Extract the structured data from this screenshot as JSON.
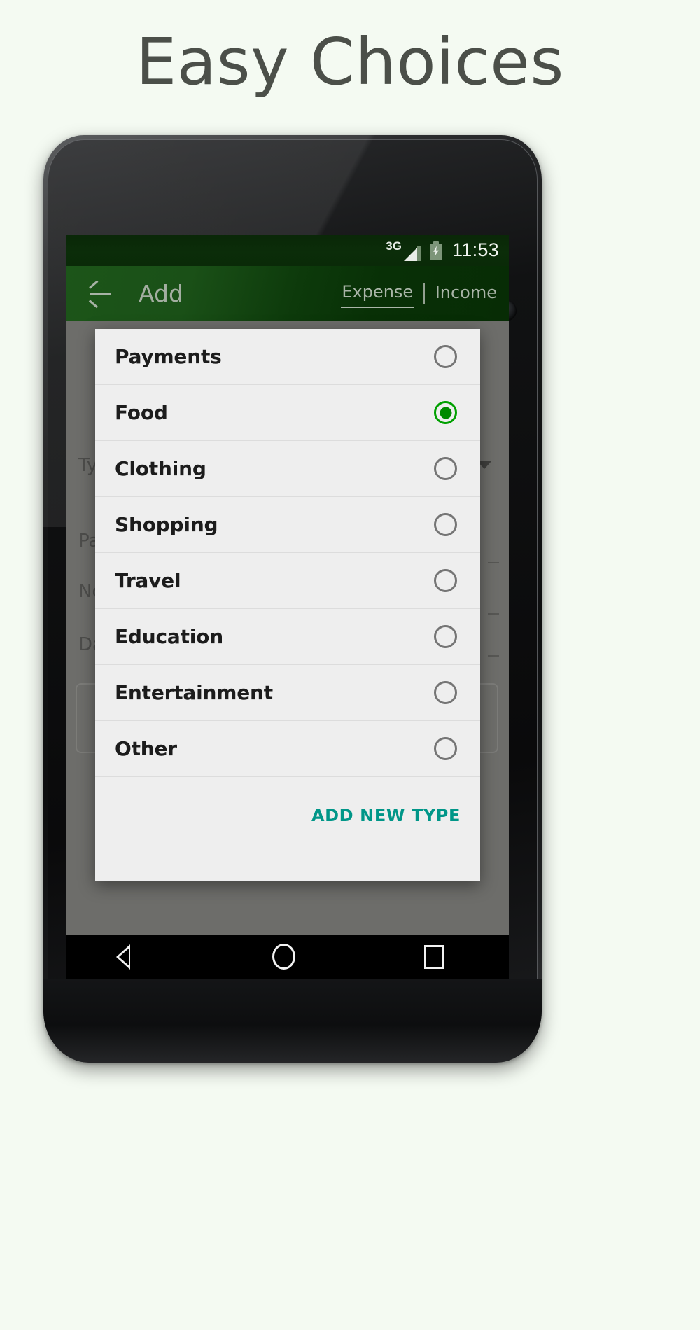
{
  "headline": "Easy Choices",
  "status_bar": {
    "network_label": "3G",
    "signal_icon": "signal-bars-icon",
    "battery_icon": "battery-charging-icon",
    "time": "11:53"
  },
  "app_bar": {
    "back_icon": "back-arrow-icon",
    "title": "Add",
    "segments": [
      {
        "label": "Expense",
        "active": true
      },
      {
        "label": "Income",
        "active": false
      }
    ]
  },
  "background_form": {
    "labels": [
      "Typ",
      "Pa",
      "No",
      "Da"
    ],
    "full_labels": [
      "Type",
      "Payment",
      "Note",
      "Date"
    ],
    "spinner_icon": "chevron-down-icon"
  },
  "dialog": {
    "options": [
      {
        "label": "Payments",
        "selected": false
      },
      {
        "label": "Food",
        "selected": true
      },
      {
        "label": "Clothing",
        "selected": false
      },
      {
        "label": "Shopping",
        "selected": false
      },
      {
        "label": "Travel",
        "selected": false
      },
      {
        "label": "Education",
        "selected": false
      },
      {
        "label": "Entertainment",
        "selected": false
      },
      {
        "label": "Other",
        "selected": false
      }
    ],
    "action_label": "ADD NEW TYPE"
  },
  "nav_bar": {
    "back_icon": "nav-back-triangle-icon",
    "home_icon": "nav-home-circle-icon",
    "recents_icon": "nav-recents-square-icon"
  },
  "colors": {
    "page_background": "#f4faf2",
    "headline_text": "#4b4f49",
    "status_bar": "#0b2d09",
    "app_bar_green": "#0d3a0b",
    "dialog_background": "#eeeeee",
    "selected_radio": "#00a000",
    "accent_teal": "#009688",
    "scrim": "#6d6d6a"
  }
}
